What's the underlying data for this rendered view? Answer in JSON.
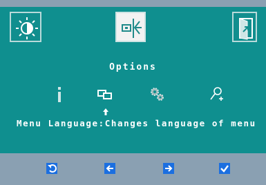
{
  "menu": {
    "title": "Options",
    "description": {
      "label": "Menu Language",
      "separator": ":",
      "text": "Changes language of menu"
    }
  },
  "tabs": [
    {
      "icon": "brightness-icon",
      "active": false
    },
    {
      "icon": "input-source-icon",
      "active": true
    },
    {
      "icon": "exit-icon",
      "active": false
    }
  ],
  "option_icons": [
    "info-icon",
    "menu-language-icon",
    "settings-gears-icon",
    "user-add-icon"
  ],
  "selected_option": "menu-language-icon",
  "buttons": [
    "back-icon",
    "left-arrow-icon",
    "right-arrow-icon",
    "checkmark-icon"
  ],
  "colors": {
    "panel": "#0f8f8f",
    "background": "#8aa0b2",
    "text": "#ffffff",
    "button": "#1b6fe0",
    "active_tab": "#f2f2f2"
  }
}
